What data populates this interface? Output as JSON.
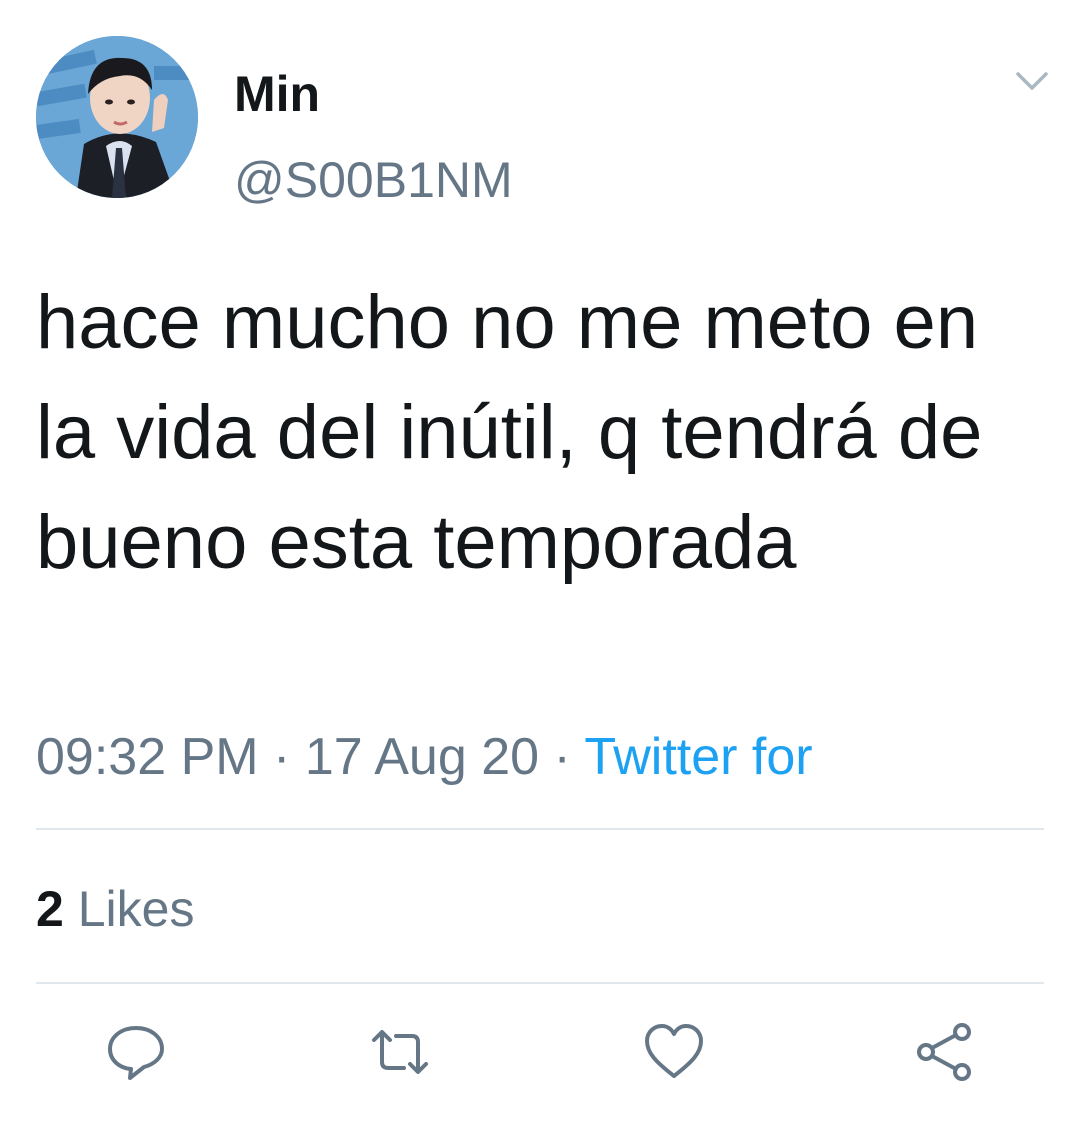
{
  "author": {
    "display_name": "Min",
    "handle": "@S00B1NM",
    "avatar_icon": "profile-photo"
  },
  "tweet": {
    "text": "hace mucho no me meto en la vida del inútil, q tendrá de bueno esta temporada",
    "time": "09:32 PM",
    "separator": "·",
    "date": "17 Aug 20",
    "source": "Twitter for"
  },
  "stats": {
    "likes_count": "2",
    "likes_label": "Likes"
  },
  "actions": {
    "reply_icon": "comment-icon",
    "retweet_icon": "retweet-icon",
    "like_icon": "heart-icon",
    "share_icon": "share-icon"
  },
  "colors": {
    "text": "#14171a",
    "muted": "#657786",
    "link": "#1da1f2",
    "divider": "#e1e8ed"
  }
}
